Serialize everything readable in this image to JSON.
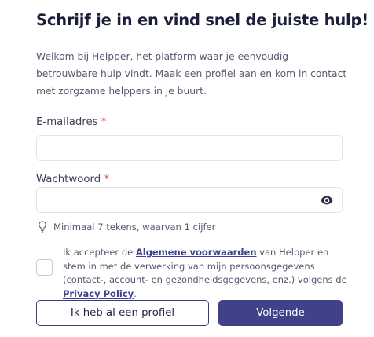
{
  "heading": "Schrijf je in en vind snel de juiste hulp!",
  "intro": "Welkom bij Helpper, het platform waar je eenvoudig betrouwbare hulp vindt. Maak een profiel aan en kom in contact met zorgzame helppers in je buurt.",
  "email": {
    "label": "E-mailadres",
    "required_mark": "*",
    "value": "",
    "placeholder": ""
  },
  "password": {
    "label": "Wachtwoord",
    "required_mark": "*",
    "value": "",
    "placeholder": "",
    "toggle_icon": "eye-icon"
  },
  "password_hint": {
    "icon": "lightbulb-icon",
    "text": "Minimaal 7 tekens, waarvan 1 cijfer"
  },
  "consent": {
    "checked": false,
    "text_before": "Ik accepteer de ",
    "terms_link": "Algemene voorwaarden",
    "text_middle": " van Helpper en stem in met de verwerking van mijn persoonsgegevens (contact-, account- en gezondheidsgegevens, enz.) volgens de ",
    "privacy_link": "Privacy Policy",
    "text_after": "."
  },
  "buttons": {
    "existing_profile": "Ik heb al een profiel",
    "next": "Volgende"
  },
  "colors": {
    "primary": "#3f4288",
    "link": "#3d4093",
    "required": "#e0533d",
    "text": "#1c1f3b"
  }
}
